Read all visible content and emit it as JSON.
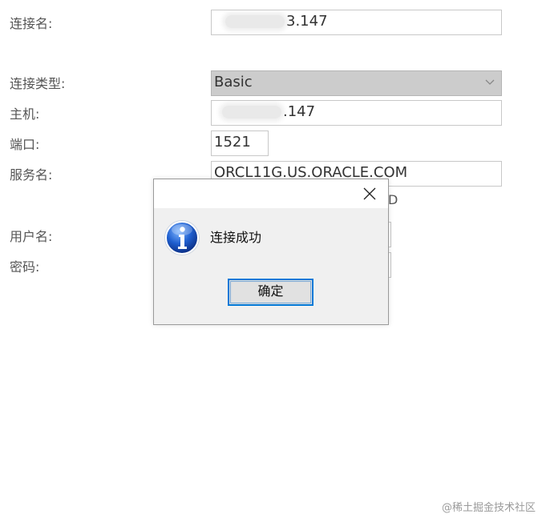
{
  "form": {
    "connection_name": {
      "label": "连接名:",
      "value_suffix": "3.147"
    },
    "connection_type": {
      "label": "连接类型:",
      "value": "Basic"
    },
    "host": {
      "label": "主机:",
      "value_suffix": ".147"
    },
    "port": {
      "label": "端口:",
      "value": "1521"
    },
    "service_name": {
      "label": "服务名:",
      "value": "ORCL11G.US.ORACLE.COM"
    },
    "username": {
      "label": "用户名:"
    },
    "password": {
      "label": "密码:"
    }
  },
  "dialog": {
    "icon": "info-icon",
    "message": "连接成功",
    "ok_label": "确定",
    "close_icon": "close-icon"
  },
  "watermark": "@稀土掘金技术社区",
  "colors": {
    "accent": "#0078d7",
    "select_bg": "#cccccc",
    "dialog_bg": "#f0f0f0"
  }
}
